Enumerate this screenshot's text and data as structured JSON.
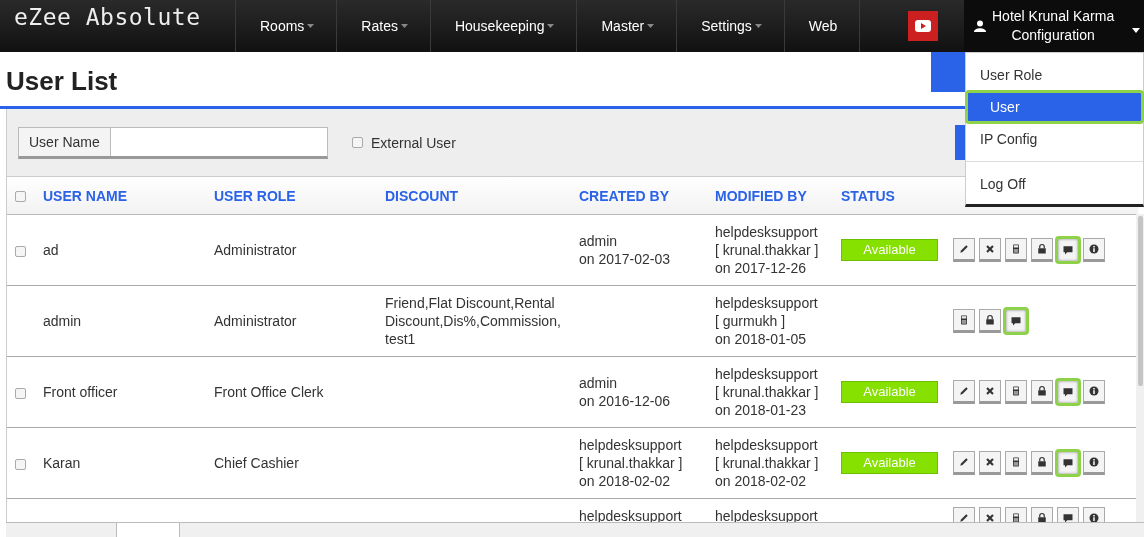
{
  "brand": "eZee Absolute",
  "nav": [
    {
      "label": "Rooms",
      "dropdown": true
    },
    {
      "label": "Rates",
      "dropdown": true
    },
    {
      "label": "Housekeeping",
      "dropdown": true
    },
    {
      "label": "Master",
      "dropdown": true
    },
    {
      "label": "Settings",
      "dropdown": true
    },
    {
      "label": "Web",
      "dropdown": false
    }
  ],
  "account": {
    "lines": [
      "Hotel Krunal Karma",
      "Configuration"
    ]
  },
  "menu": [
    {
      "label": "User Role",
      "selected": false,
      "highlighted": false,
      "divider_before": false
    },
    {
      "label": "User",
      "selected": true,
      "highlighted": true,
      "divider_before": false
    },
    {
      "label": "IP Config",
      "selected": false,
      "highlighted": false,
      "divider_before": false
    },
    {
      "label": "Log Off",
      "selected": false,
      "highlighted": false,
      "divider_before": true
    }
  ],
  "page_title": "User List",
  "filter": {
    "label": "User Name",
    "checkbox_label": "External User",
    "checked": false
  },
  "select_all_checked": false,
  "columns": [
    "USER NAME",
    "USER ROLE",
    "DISCOUNT",
    "CREATED BY",
    "MODIFIED BY",
    "STATUS"
  ],
  "rows": [
    {
      "has_checkbox": true,
      "checked": false,
      "user_name": "ad",
      "user_role": "Administrator",
      "created_by": [
        "admin",
        "on 2017-02-03"
      ],
      "modified_by": [
        "helpdesksupport",
        "[ krunal.thakkar ]",
        "on 2017-12-26"
      ],
      "status": "Available",
      "actions": [
        {
          "kind": "edit",
          "highlighted": false
        },
        {
          "kind": "delete",
          "highlighted": false
        },
        {
          "kind": "calculator",
          "highlighted": false
        },
        {
          "kind": "lock",
          "highlighted": false
        },
        {
          "kind": "comment",
          "highlighted": true
        },
        {
          "kind": "info",
          "highlighted": false
        }
      ]
    },
    {
      "has_checkbox": false,
      "user_name": "admin",
      "user_role": "Administrator",
      "discount": "Friend,Flat Discount,Rental Discount,Dis%,Commission, test1",
      "modified_by": [
        "helpdesksupport",
        "[ gurmukh ]",
        "on 2018-01-05"
      ],
      "actions": [
        {
          "kind": "calculator",
          "highlighted": false
        },
        {
          "kind": "lock",
          "highlighted": false
        },
        {
          "kind": "comment",
          "highlighted": true
        }
      ]
    },
    {
      "has_checkbox": true,
      "checked": false,
      "user_name": "Front officer",
      "user_role": "Front Office Clerk",
      "created_by": [
        "admin",
        "on 2016-12-06"
      ],
      "modified_by": [
        "helpdesksupport",
        "[ krunal.thakkar ]",
        "on 2018-01-23"
      ],
      "status": "Available",
      "actions": [
        {
          "kind": "edit",
          "highlighted": false
        },
        {
          "kind": "delete",
          "highlighted": false
        },
        {
          "kind": "calculator",
          "highlighted": false
        },
        {
          "kind": "lock",
          "highlighted": false
        },
        {
          "kind": "comment",
          "highlighted": true
        },
        {
          "kind": "info",
          "highlighted": false
        }
      ]
    },
    {
      "has_checkbox": true,
      "checked": false,
      "user_name": "Karan",
      "user_role": "Chief Cashier",
      "created_by": [
        "helpdesksupport",
        "[ krunal.thakkar ]",
        "on 2018-02-02"
      ],
      "modified_by": [
        "helpdesksupport",
        "[ krunal.thakkar ]",
        "on 2018-02-02"
      ],
      "status": "Available",
      "actions": [
        {
          "kind": "edit",
          "highlighted": false
        },
        {
          "kind": "delete",
          "highlighted": false
        },
        {
          "kind": "calculator",
          "highlighted": false
        },
        {
          "kind": "lock",
          "highlighted": false
        },
        {
          "kind": "comment",
          "highlighted": true
        },
        {
          "kind": "info",
          "highlighted": false
        }
      ]
    },
    {
      "has_checkbox": false,
      "created_by": [
        "helpdesksupport"
      ],
      "modified_by": [
        "helpdesksupport"
      ],
      "actions": [
        {
          "kind": "edit",
          "highlighted": false
        },
        {
          "kind": "delete",
          "highlighted": false
        },
        {
          "kind": "calculator",
          "highlighted": false
        },
        {
          "kind": "lock",
          "highlighted": false
        },
        {
          "kind": "comment",
          "highlighted": false
        },
        {
          "kind": "info",
          "highlighted": false
        }
      ]
    }
  ]
}
